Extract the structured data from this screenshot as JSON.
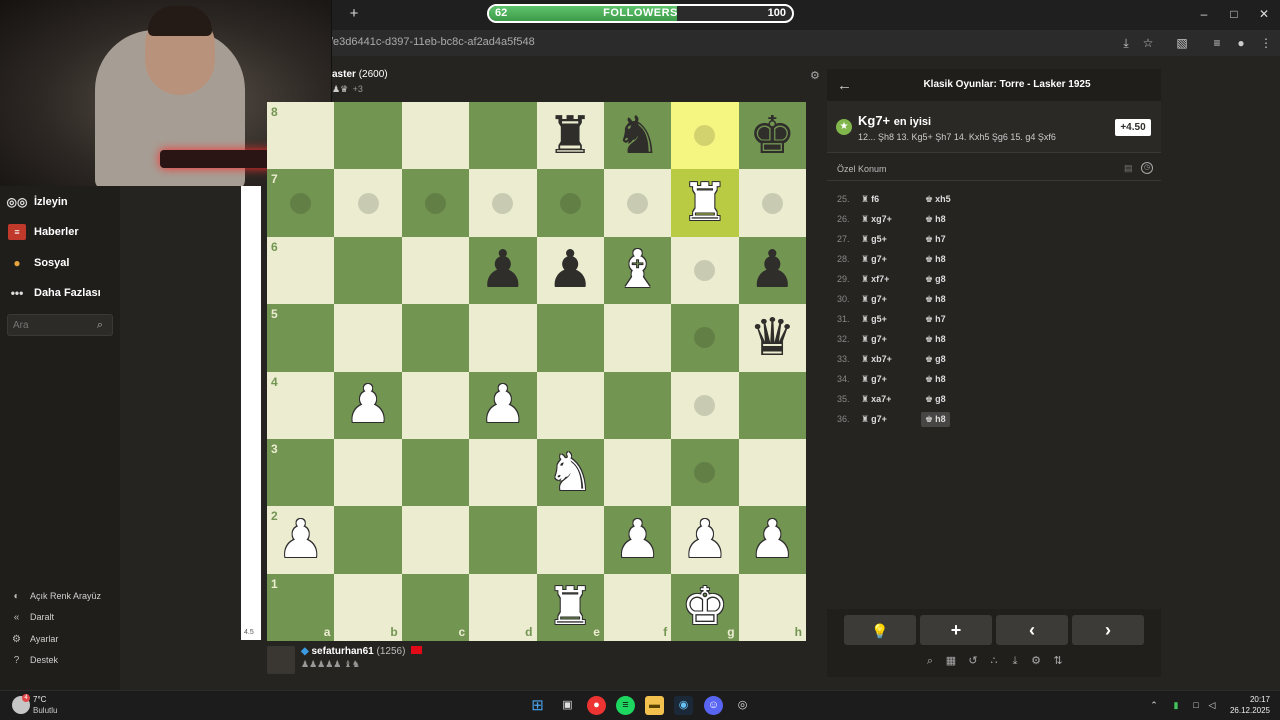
{
  "browser": {
    "url": "/e3d6441c-d397-11eb-bc8c-af2ad4a5f548",
    "new_tab": "+"
  },
  "followers_goal": {
    "current": "62",
    "label": "FOLLOWERS",
    "target": "100",
    "progress": 0.62
  },
  "sidebar": {
    "nav": [
      {
        "label": "İzleyin",
        "icon": "binoculars-icon"
      },
      {
        "label": "Haberler",
        "icon": "news-icon"
      },
      {
        "label": "Sosyal",
        "icon": "people-icon"
      },
      {
        "label": "Daha Fazlası",
        "icon": "more-icon"
      }
    ],
    "search_placeholder": "Ara",
    "footer": [
      {
        "label": "Açık Renk Arayüz",
        "icon": "theme-icon"
      },
      {
        "label": "Daralt",
        "icon": "collapse-icon"
      },
      {
        "label": "Ayarlar",
        "icon": "gear-icon"
      },
      {
        "label": "Destek",
        "icon": "help-icon"
      }
    ]
  },
  "top_player": {
    "name": "aster",
    "rating": "(2600)",
    "captured_extra": "+3"
  },
  "bottom_player": {
    "name": "sefaturhan61",
    "rating": "(1256)"
  },
  "eval_bar_label": "4.5",
  "board": {
    "files": [
      "a",
      "b",
      "c",
      "d",
      "e",
      "f",
      "g",
      "h"
    ],
    "ranks": [
      "8",
      "7",
      "6",
      "5",
      "4",
      "3",
      "2",
      "1"
    ],
    "rows": [
      [
        "",
        "",
        "",
        "",
        "br",
        "bn",
        "",
        "bk"
      ],
      [
        "",
        "",
        "",
        "",
        "",
        "",
        "wr",
        ""
      ],
      [
        "",
        "",
        "",
        "bp",
        "bp",
        "wb",
        "",
        "bp"
      ],
      [
        "",
        "",
        "",
        "",
        "",
        "",
        "",
        "bq"
      ],
      [
        "",
        "wp",
        "",
        "wp",
        "",
        "",
        "",
        ""
      ],
      [
        "",
        "",
        "",
        "",
        "wn",
        "",
        "",
        ""
      ],
      [
        "wp",
        "",
        "",
        "",
        "",
        "wp",
        "wp",
        "wp"
      ],
      [
        "",
        "",
        "",
        "",
        "wr",
        "",
        "wk",
        ""
      ]
    ],
    "dots": [
      "a7",
      "b7",
      "c7",
      "d7",
      "e7",
      "f7",
      "h7",
      "g8",
      "g6",
      "g5",
      "g4",
      "g3"
    ],
    "highlights": [
      "g8",
      "g7"
    ]
  },
  "panel": {
    "title": "Klasik Oyunlar: Torre - Lasker 1925",
    "best_move": "Kg7+",
    "best_tag": "en iyisi",
    "best_line": "12... Şh8 13. Kg5+ Şh7 14. Kxh5 Şg6 15. g4 Şxf6",
    "eval": "+4.50",
    "custom_position": "Özel Konum",
    "moves": [
      {
        "num": "25.",
        "white": "f6",
        "black": "xh5"
      },
      {
        "num": "26.",
        "white": "xg7+",
        "black": "h8"
      },
      {
        "num": "27.",
        "white": "g5+",
        "black": "h7"
      },
      {
        "num": "28.",
        "white": "g7+",
        "black": "h8"
      },
      {
        "num": "29.",
        "white": "xf7+",
        "black": "g8"
      },
      {
        "num": "30.",
        "white": "g7+",
        "black": "h8"
      },
      {
        "num": "31.",
        "white": "g5+",
        "black": "h7"
      },
      {
        "num": "32.",
        "white": "g7+",
        "black": "h8"
      },
      {
        "num": "33.",
        "white": "xb7+",
        "black": "g8"
      },
      {
        "num": "34.",
        "white": "g7+",
        "black": "h8"
      },
      {
        "num": "35.",
        "white": "xa7+",
        "black": "g8"
      },
      {
        "num": "36.",
        "white": "g7+",
        "black": "h8"
      }
    ],
    "controls": [
      "hint",
      "add",
      "prev",
      "next"
    ]
  },
  "taskbar": {
    "weather_temp": "7°C",
    "weather_desc": "Bulutlu",
    "weather_badge": "4",
    "time": "20:17",
    "date": "26.12.2025"
  }
}
